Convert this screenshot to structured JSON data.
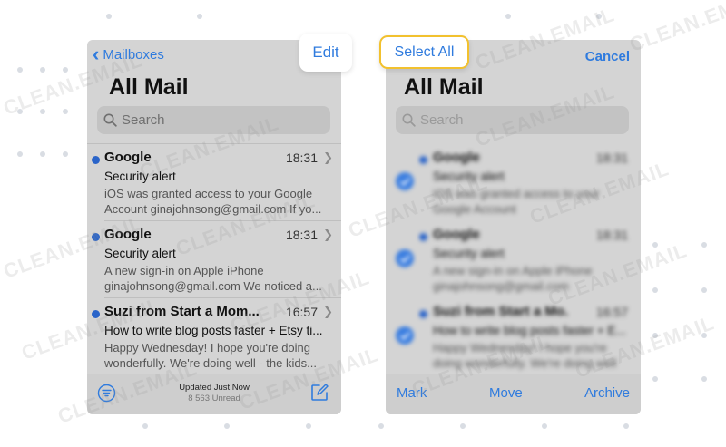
{
  "left_screen": {
    "back_label": "Mailboxes",
    "title": "All Mail",
    "search_placeholder": "Search",
    "emails": [
      {
        "sender": "Google",
        "time": "18:31",
        "subject": "Security alert",
        "preview": "iOS was granted access to your Google Account ginajohnsong@gmail.com If yo...",
        "unread": true
      },
      {
        "sender": "Google",
        "time": "18:31",
        "subject": "Security alert",
        "preview": "A new sign-in on Apple iPhone ginajohnsong@gmail.com We noticed a...",
        "unread": true
      },
      {
        "sender": "Suzi from Start a Mom...",
        "time": "16:57",
        "subject": "How to write blog posts faster + Etsy ti...",
        "preview": "Happy Wednesday! I hope you're doing wonderfully. We're doing well - the kids...",
        "unread": true
      }
    ],
    "footer": {
      "status": "Updated Just Now",
      "unread": "8 563 Unread"
    }
  },
  "edit_button": {
    "label": "Edit"
  },
  "right_screen": {
    "select_all_label": "Select All",
    "cancel_label": "Cancel",
    "title": "All Mail",
    "search_placeholder": "Search",
    "emails": [
      {
        "sender": "Google",
        "time": "18:31",
        "subject": "Security alert",
        "preview": "iOS was granted access to your Google Account ginajohnsong@gmail.com",
        "selected": true
      },
      {
        "sender": "Google",
        "time": "18:31",
        "subject": "Security alert",
        "preview": "A new sign-in on Apple iPhone ginajohnsong@gmail.com",
        "selected": true
      },
      {
        "sender": "Suzi from Start a Mo...",
        "time": "16:57",
        "subject": "How to write blog posts faster + E...",
        "preview": "Happy Wednesday! I hope you're doing wonderfully. We're doing well",
        "selected": true
      }
    ],
    "toolbar": {
      "mark": "Mark",
      "move": "Move",
      "archive": "Archive"
    }
  },
  "watermark": "CLEAN.EMAIL",
  "colors": {
    "accent": "#2f7bde",
    "highlight_border": "#f2c12e",
    "unread_dot": "#2a64c9"
  }
}
